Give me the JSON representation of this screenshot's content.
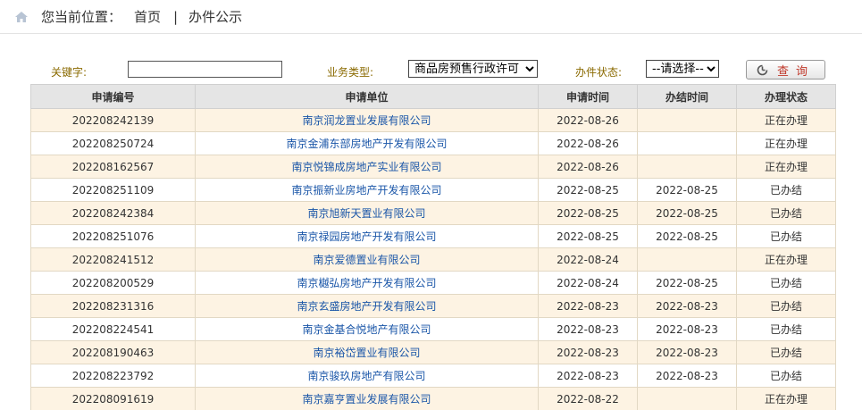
{
  "breadcrumb": {
    "label": "您当前位置：",
    "home": "首页",
    "separator": "|",
    "current": "办件公示"
  },
  "filters": {
    "keyword_label": "关键字:",
    "keyword_value": "",
    "type_label": "业务类型:",
    "type_selected": "商品房预售行政许可",
    "status_label": "办件状态:",
    "status_selected": "--请选择--",
    "query_label": "查询"
  },
  "table": {
    "headers": [
      "申请编号",
      "申请单位",
      "申请时间",
      "办结时间",
      "办理状态"
    ],
    "rows": [
      [
        "202208242139",
        "南京润龙置业发展有限公司",
        "2022-08-26",
        "",
        "正在办理"
      ],
      [
        "202208250724",
        "南京金浦东部房地产开发有限公司",
        "2022-08-26",
        "",
        "正在办理"
      ],
      [
        "202208162567",
        "南京悦锦成房地产实业有限公司",
        "2022-08-26",
        "",
        "正在办理"
      ],
      [
        "202208251109",
        "南京振新业房地产开发有限公司",
        "2022-08-25",
        "2022-08-25",
        "已办结"
      ],
      [
        "202208242384",
        "南京旭新天置业有限公司",
        "2022-08-25",
        "2022-08-25",
        "已办结"
      ],
      [
        "202208251076",
        "南京禄园房地产开发有限公司",
        "2022-08-25",
        "2022-08-25",
        "已办结"
      ],
      [
        "202208241512",
        "南京爱德置业有限公司",
        "2022-08-24",
        "",
        "正在办理"
      ],
      [
        "202208200529",
        "南京樾弘房地产开发有限公司",
        "2022-08-24",
        "2022-08-25",
        "已办结"
      ],
      [
        "202208231316",
        "南京玄盛房地产开发有限公司",
        "2022-08-23",
        "2022-08-23",
        "已办结"
      ],
      [
        "202208224541",
        "南京金基合悦地产有限公司",
        "2022-08-23",
        "2022-08-23",
        "已办结"
      ],
      [
        "202208190463",
        "南京裕岱置业有限公司",
        "2022-08-23",
        "2022-08-23",
        "已办结"
      ],
      [
        "202208223792",
        "南京骏玖房地产有限公司",
        "2022-08-23",
        "2022-08-23",
        "已办结"
      ],
      [
        "202208091619",
        "南京嘉亨置业发展有限公司",
        "2022-08-22",
        "",
        "正在办理"
      ]
    ]
  }
}
